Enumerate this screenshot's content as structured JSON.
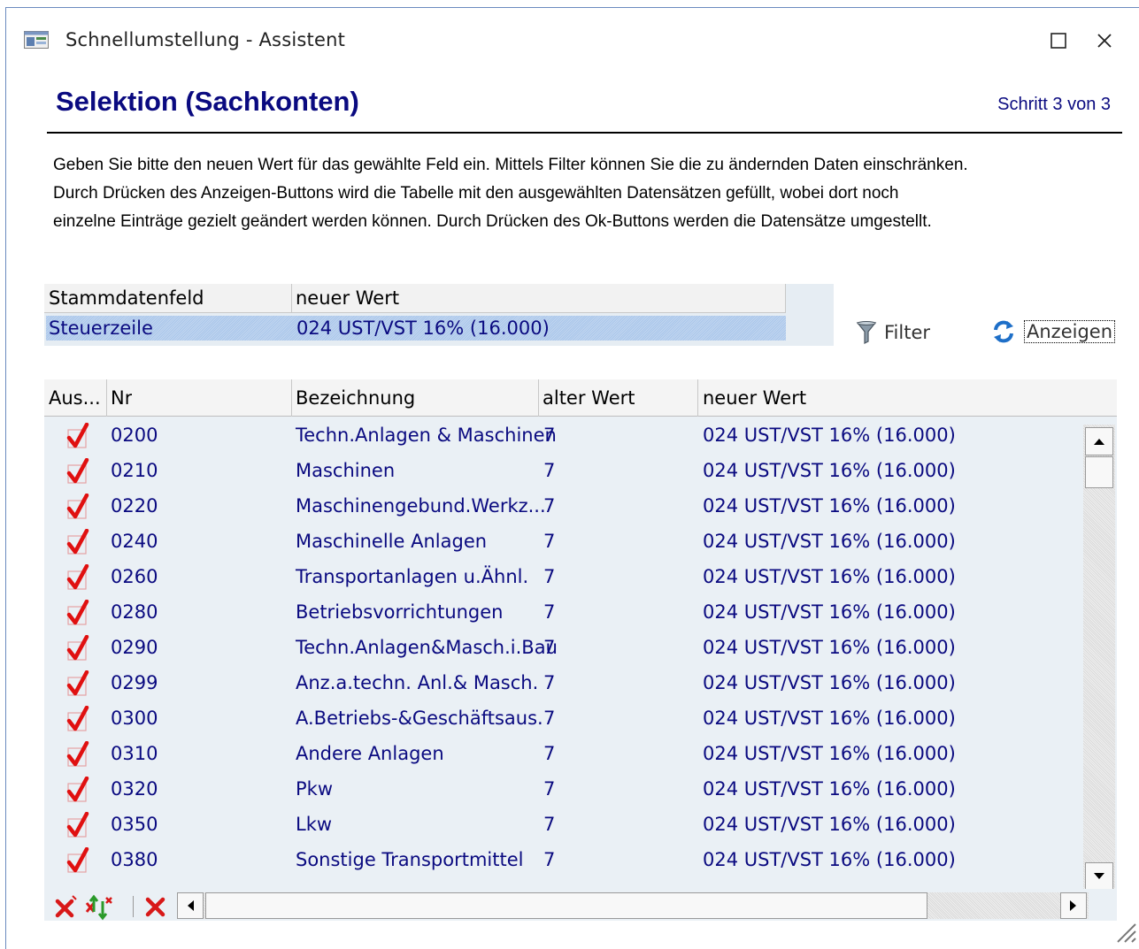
{
  "window": {
    "title": "Schnellumstellung - Assistent",
    "maximize_symbol": "☐",
    "close_symbol": "×"
  },
  "header": {
    "title": "Selektion (Sachkonten)",
    "step": "Schritt 3 von 3"
  },
  "description": {
    "line1": "Geben Sie bitte den neuen Wert für das gewählte Feld ein. Mittels Filter können Sie die zu ändernden Daten einschränken.",
    "line2": "Durch Drücken des Anzeigen-Buttons wird die Tabelle mit den ausgewählten Datensätzen gefüllt, wobei dort noch",
    "line3": "einzelne Einträge gezielt geändert werden können. Durch Drücken des Ok-Buttons werden die Datensätze umgestellt."
  },
  "selection": {
    "columns": [
      "Stammdatenfeld",
      "neuer Wert"
    ],
    "row": {
      "field": "Steuerzeile",
      "value": "024 UST/VST 16% (16.000)"
    }
  },
  "buttons": {
    "filter": "Filter",
    "show": "Anzeigen"
  },
  "grid": {
    "columns": [
      "Aus...",
      "Nr",
      "Bezeichnung",
      "alter Wert",
      "neuer Wert"
    ],
    "rows": [
      {
        "checked": true,
        "nr": "0200",
        "bez": "Techn.Anlagen & Maschinen",
        "alt": "7",
        "neu": "024 UST/VST 16% (16.000)"
      },
      {
        "checked": true,
        "nr": "0210",
        "bez": "Maschinen",
        "alt": "7",
        "neu": "024 UST/VST 16% (16.000)"
      },
      {
        "checked": true,
        "nr": "0220",
        "bez": "Maschinengebund.Werkz...",
        "alt": "7",
        "neu": "024 UST/VST 16% (16.000)"
      },
      {
        "checked": true,
        "nr": "0240",
        "bez": "Maschinelle Anlagen",
        "alt": "7",
        "neu": "024 UST/VST 16% (16.000)"
      },
      {
        "checked": true,
        "nr": "0260",
        "bez": "Transportanlagen u.Ähnl.",
        "alt": "7",
        "neu": "024 UST/VST 16% (16.000)"
      },
      {
        "checked": true,
        "nr": "0280",
        "bez": "Betriebsvorrichtungen",
        "alt": "7",
        "neu": "024 UST/VST 16% (16.000)"
      },
      {
        "checked": true,
        "nr": "0290",
        "bez": "Techn.Anlagen&Masch.i.Bau",
        "alt": "7",
        "neu": "024 UST/VST 16% (16.000)"
      },
      {
        "checked": true,
        "nr": "0299",
        "bez": "Anz.a.techn. Anl.& Masch.",
        "alt": "7",
        "neu": "024 UST/VST 16% (16.000)"
      },
      {
        "checked": true,
        "nr": "0300",
        "bez": "A.Betriebs-&Geschäftsaus.",
        "alt": "7",
        "neu": "024 UST/VST 16% (16.000)"
      },
      {
        "checked": true,
        "nr": "0310",
        "bez": "Andere Anlagen",
        "alt": "7",
        "neu": "024 UST/VST 16% (16.000)"
      },
      {
        "checked": true,
        "nr": "0320",
        "bez": "Pkw",
        "alt": "7",
        "neu": "024 UST/VST 16% (16.000)"
      },
      {
        "checked": true,
        "nr": "0350",
        "bez": "Lkw",
        "alt": "7",
        "neu": "024 UST/VST 16% (16.000)"
      },
      {
        "checked": true,
        "nr": "0380",
        "bez": "Sonstige Transportmittel",
        "alt": "7",
        "neu": "024 UST/VST 16% (16.000)"
      }
    ]
  },
  "colors": {
    "heading": "#0a0a80",
    "cell_text": "#0a0a80",
    "check": "#e01010",
    "selection_row": "#b4cdee"
  },
  "icons": {
    "app": "app-window-icon",
    "filter": "funnel-icon",
    "show": "refresh-arrows-icon",
    "footer": [
      "uncheck-all-icon",
      "toggle-selection-icon",
      "delete-icon"
    ]
  }
}
